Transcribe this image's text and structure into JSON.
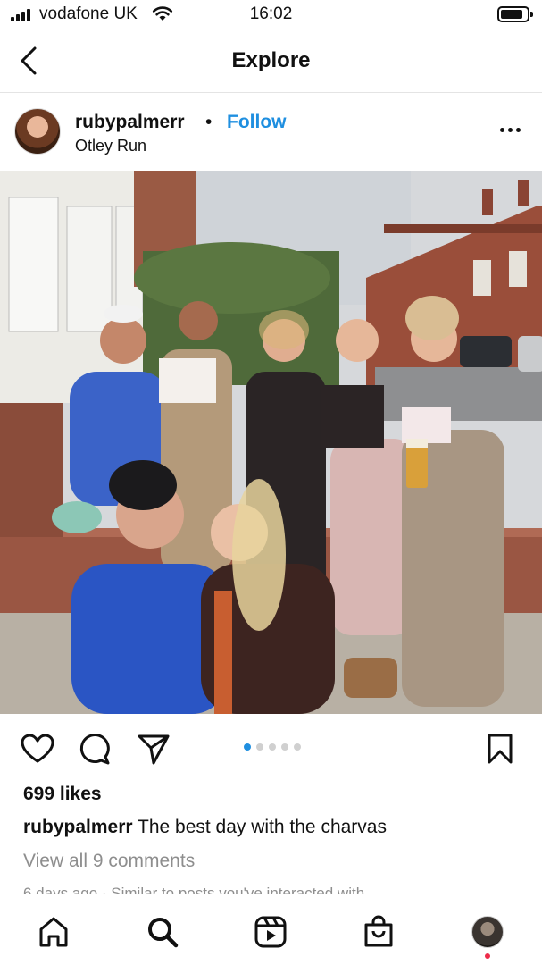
{
  "status_bar": {
    "carrier": "vodafone UK",
    "time": "16:02"
  },
  "header": {
    "title": "Explore"
  },
  "post": {
    "username": "rubypalmerr",
    "separator": "•",
    "follow_label": "Follow",
    "location": "Otley Run",
    "likes": "699 likes",
    "caption_user": "rubypalmerr",
    "caption_text": " The best day with the charvas",
    "view_comments": "View all 9 comments",
    "timestamp": "6 days ago · Similar to posts you've interacted with",
    "carousel": {
      "count": 5,
      "active_index": 0
    }
  },
  "icons": {
    "back": "chevron-left-icon",
    "more": "more-horizontal-icon",
    "like": "heart-icon",
    "comment": "comment-icon",
    "share": "paper-plane-icon",
    "save": "bookmark-icon",
    "tabs": [
      "home-icon",
      "search-icon",
      "reels-icon",
      "shop-icon",
      "profile-avatar"
    ]
  },
  "colors": {
    "accent": "#1f8fe0",
    "muted_text": "#8e8e8e",
    "notification": "#ee2c4a"
  }
}
